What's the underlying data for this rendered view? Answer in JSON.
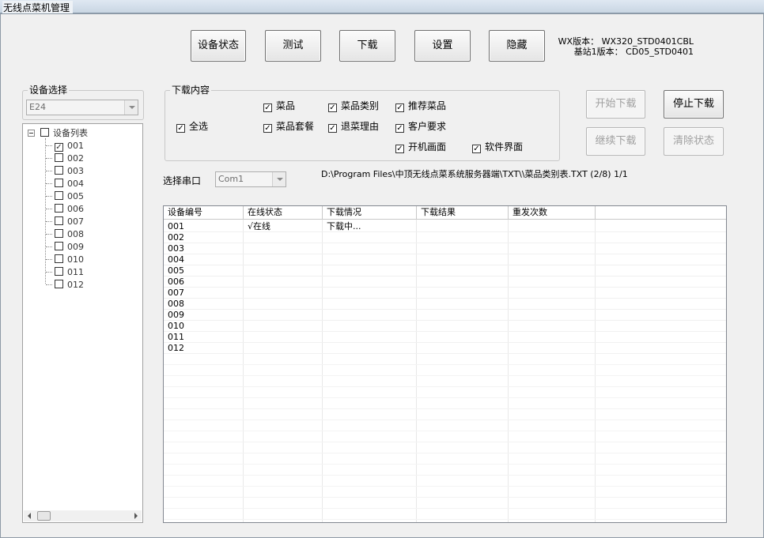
{
  "window": {
    "title": "无线点菜机管理"
  },
  "toolbar": {
    "device_status": "设备状态",
    "test": "测试",
    "download": "下载",
    "settings": "设置",
    "hide": "隐藏"
  },
  "version": {
    "wx": "WX版本：  WX320_STD0401CBL",
    "base": "基站1版本：  CD05_STD0401"
  },
  "device_select": {
    "legend": "设备选择",
    "value": "E24"
  },
  "tree": {
    "root_label": "设备列表",
    "items": [
      {
        "label": "001",
        "checked": true
      },
      {
        "label": "002",
        "checked": false
      },
      {
        "label": "003",
        "checked": false
      },
      {
        "label": "004",
        "checked": false
      },
      {
        "label": "005",
        "checked": false
      },
      {
        "label": "006",
        "checked": false
      },
      {
        "label": "007",
        "checked": false
      },
      {
        "label": "008",
        "checked": false
      },
      {
        "label": "009",
        "checked": false
      },
      {
        "label": "010",
        "checked": false
      },
      {
        "label": "011",
        "checked": false
      },
      {
        "label": "012",
        "checked": false
      }
    ]
  },
  "download_content": {
    "legend": "下载内容",
    "select_all": "全选",
    "dishes": "菜品",
    "dish_category": "菜品类别",
    "recommended": "推荐菜品",
    "dish_set": "菜品套餐",
    "return_reason": "退菜理由",
    "customer_request": "客户要求",
    "boot_screen": "开机画面",
    "software_ui": "软件界面"
  },
  "actions": {
    "start_download": "开始下载",
    "stop_download": "停止下载",
    "continue_download": "继续下载",
    "clear_status": "清除状态"
  },
  "serial": {
    "label": "选择串口",
    "value": "Com1"
  },
  "path_status": "D:\\Program Files\\中顶无线点菜系统服务器端\\TXT\\\\菜品类别表.TXT (2/8) 1/1",
  "table": {
    "headers": [
      "设备编号",
      "在线状态",
      "下载情况",
      "下载结果",
      "重发次数"
    ],
    "rows": [
      [
        "001",
        "√在线",
        "下载中...",
        "",
        ""
      ],
      [
        "002",
        "",
        "",
        "",
        ""
      ],
      [
        "003",
        "",
        "",
        "",
        ""
      ],
      [
        "004",
        "",
        "",
        "",
        ""
      ],
      [
        "005",
        "",
        "",
        "",
        ""
      ],
      [
        "006",
        "",
        "",
        "",
        ""
      ],
      [
        "007",
        "",
        "",
        "",
        ""
      ],
      [
        "008",
        "",
        "",
        "",
        ""
      ],
      [
        "009",
        "",
        "",
        "",
        ""
      ],
      [
        "010",
        "",
        "",
        "",
        ""
      ],
      [
        "011",
        "",
        "",
        "",
        ""
      ],
      [
        "012",
        "",
        "",
        "",
        ""
      ]
    ]
  }
}
